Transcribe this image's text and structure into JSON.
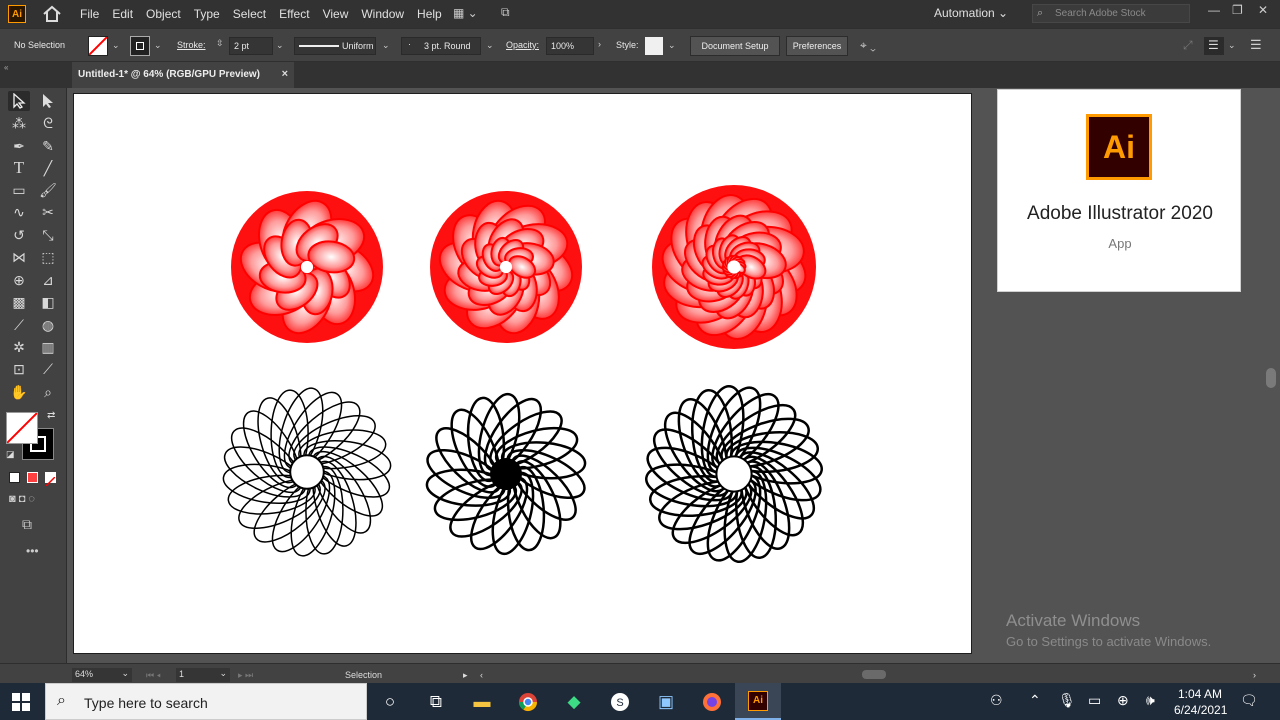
{
  "menubar": {
    "app_icon": "Ai",
    "items": [
      "File",
      "Edit",
      "Object",
      "Type",
      "Select",
      "Effect",
      "View",
      "Window",
      "Help"
    ],
    "workspace": "Automation",
    "search_placeholder": "Search Adobe Stock"
  },
  "controlbar": {
    "selection_label": "No Selection",
    "stroke_label": "Stroke:",
    "stroke_value": "2 pt",
    "profile_label": "Uniform",
    "brush_label": "3 pt. Round",
    "opacity_label": "Opacity:",
    "opacity_value": "100%",
    "style_label": "Style:",
    "document_setup": "Document Setup",
    "preferences": "Preferences"
  },
  "document_tab": {
    "title": "Untitled-1* @ 64% (RGB/GPU Preview)",
    "close": "×"
  },
  "tools": [
    "selection-tool",
    "direct-selection-tool",
    "magic-wand-tool",
    "lasso-tool",
    "pen-tool",
    "curvature-tool",
    "type-tool",
    "line-tool",
    "rectangle-tool",
    "paintbrush-tool",
    "shaper-tool",
    "scissors-tool",
    "rotate-tool",
    "scale-tool",
    "width-tool",
    "free-transform-tool",
    "shape-builder-tool",
    "perspective-grid-tool",
    "mesh-tool",
    "gradient-tool",
    "eyedropper-tool",
    "blend-tool",
    "symbol-sprayer-tool",
    "column-graph-tool",
    "artboard-tool",
    "slice-tool",
    "hand-tool",
    "zoom-tool"
  ],
  "colors": {
    "accent_red": "#ff0000",
    "ui_dark": "#323232",
    "ui_panel": "#424242",
    "canvas_bg": "#535353",
    "ai_orange": "#ff9a00",
    "taskbar": "#1f2a38"
  },
  "popup": {
    "logo": "Ai",
    "title": "Adobe Illustrator 2020",
    "subtitle": "App"
  },
  "activate_windows": {
    "title": "Activate Windows",
    "subtitle": "Go to Settings to activate Windows."
  },
  "statusbar": {
    "zoom": "64%",
    "artboard_number": "1",
    "current_tool": "Selection"
  },
  "taskbar": {
    "search_placeholder": "Type here to search",
    "time": "1:04 AM",
    "date": "6/24/2021",
    "active_app": "Ai"
  }
}
